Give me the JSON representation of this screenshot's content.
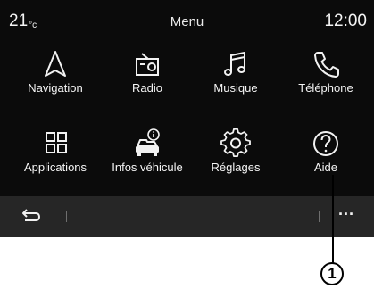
{
  "status": {
    "temperature": "21",
    "temperature_unit": "°c",
    "title": "Menu",
    "time": "12:00"
  },
  "menu_items": [
    {
      "label": "Navigation",
      "icon": "navigation-arrow-icon"
    },
    {
      "label": "Radio",
      "icon": "radio-icon"
    },
    {
      "label": "Musique",
      "icon": "music-note-icon"
    },
    {
      "label": "Téléphone",
      "icon": "phone-icon"
    },
    {
      "label": "Applications",
      "icon": "apps-grid-icon"
    },
    {
      "label": "Infos véhicule",
      "icon": "vehicle-info-icon"
    },
    {
      "label": "Réglages",
      "icon": "gear-icon"
    },
    {
      "label": "Aide",
      "icon": "help-question-icon"
    }
  ],
  "bottom_bar": {
    "more_label": "···",
    "back_icon": "back-arrow-icon"
  },
  "callout": {
    "number": "1"
  },
  "colors": {
    "screen_bg": "#0b0b0b",
    "bar_bg": "#262626",
    "text": "#f5f5f5"
  }
}
